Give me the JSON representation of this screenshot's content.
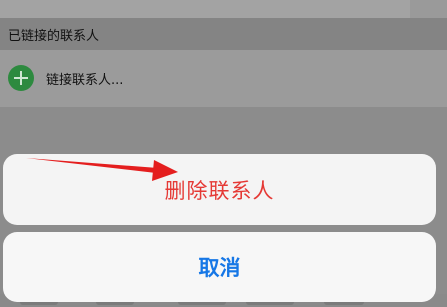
{
  "section_header": {
    "label": "已链接的联系人"
  },
  "link_row": {
    "icon": "plus-circle-icon",
    "label": "链接联系人..."
  },
  "action_sheet": {
    "delete_label": "删除联系人",
    "cancel_label": "取消"
  },
  "colors": {
    "dim_overlay": "#8a8a8a",
    "destructive": "#e53935",
    "cancel": "#1677e6",
    "plus_icon": "#2d8a3f",
    "annotation_arrow": "#e41e1e"
  }
}
